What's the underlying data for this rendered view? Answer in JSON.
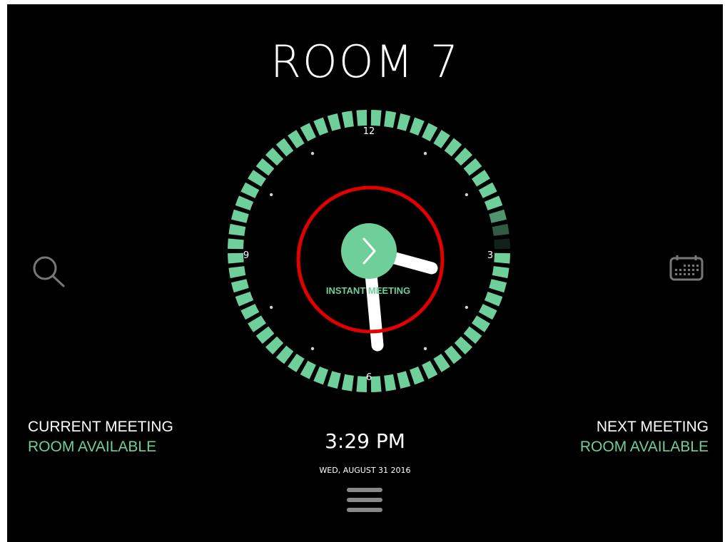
{
  "room": {
    "title": "ROOM 7"
  },
  "clock": {
    "numerals": {
      "n12": "12",
      "n3": "3",
      "n6": "6",
      "n9": "9"
    },
    "instant_meeting_label": "INSTANT MEETING",
    "hour_hand_time": "3:29",
    "accent_color": "#6fcf9b",
    "highlight_ring_color": "#e00000"
  },
  "current_meeting": {
    "heading": "CURRENT MEETING",
    "status": "ROOM AVAILABLE"
  },
  "next_meeting": {
    "heading": "NEXT MEETING",
    "status": "ROOM AVAILABLE"
  },
  "datetime": {
    "time": "3:29 PM",
    "date": "WED, AUGUST 31 2016"
  },
  "icons": {
    "left": "search-icon",
    "right": "calendar-icon",
    "bottom": "hamburger-menu-icon"
  }
}
